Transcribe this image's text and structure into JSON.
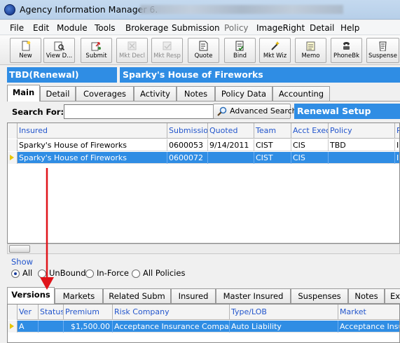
{
  "window": {
    "title": "Agency Information Manager 6."
  },
  "menu": [
    "File",
    "Edit",
    "Module",
    "Tools",
    "Brokerage",
    "Submission",
    "Policy",
    "ImageRight",
    "Detail",
    "Help"
  ],
  "menu_disabled": [
    "Policy"
  ],
  "toolbar": {
    "buttons": [
      {
        "label": "New",
        "icon": "new-document-icon",
        "enabled": true
      },
      {
        "label": "View D...",
        "icon": "view-document-icon",
        "enabled": true
      },
      {
        "label": "Submit",
        "icon": "submit-icon",
        "enabled": true
      },
      {
        "label": "Mkt Decl",
        "icon": "market-decline-icon",
        "enabled": false
      },
      {
        "label": "Mkt Resp",
        "icon": "market-response-icon",
        "enabled": false
      },
      {
        "label": "Quote",
        "icon": "quote-icon",
        "enabled": true
      },
      {
        "label": "Bind",
        "icon": "bind-icon",
        "enabled": true
      },
      {
        "label": "Mkt Wiz",
        "icon": "market-wizard-icon",
        "enabled": true
      },
      {
        "label": "Memo",
        "icon": "memo-icon",
        "enabled": true
      },
      {
        "label": "PhoneBk",
        "icon": "phonebook-icon",
        "enabled": true
      },
      {
        "label": "Suspense",
        "icon": "suspense-icon",
        "enabled": true
      }
    ]
  },
  "status": {
    "left": "TBD(Renewal)",
    "right": "Sparky's House of Fireworks"
  },
  "main_tabs": [
    {
      "label": "Main",
      "active": true
    },
    {
      "label": "Detail",
      "active": false
    },
    {
      "label": "Coverages",
      "active": false
    },
    {
      "label": "Activity",
      "active": false
    },
    {
      "label": "Notes",
      "active": false
    },
    {
      "label": "Policy Data",
      "active": false
    },
    {
      "label": "Accounting",
      "active": false
    }
  ],
  "search": {
    "label": "Search For:",
    "value": "",
    "advanced_button": "Advanced Search",
    "renewal_setup": "Renewal Setup"
  },
  "submissions_grid": {
    "columns": [
      "Insured",
      "Submission",
      "Quoted",
      "Team",
      "Acct Exec",
      "Policy",
      "R"
    ],
    "rows": [
      {
        "cells": [
          "Sparky's House of Fireworks",
          "0600053",
          "9/14/2011",
          "CIST",
          "CIS",
          "TBD",
          "I"
        ],
        "selected": false
      },
      {
        "cells": [
          "Sparky's House of Fireworks",
          "0600072",
          "",
          "CIST",
          "CIS",
          "",
          "I"
        ],
        "selected": true
      }
    ]
  },
  "show": {
    "label": "Show",
    "options": [
      {
        "label": "All",
        "checked": true
      },
      {
        "label": "UnBound",
        "checked": false
      },
      {
        "label": "In-Force",
        "checked": false
      },
      {
        "label": "All Policies",
        "checked": false
      }
    ]
  },
  "bottom_tabs": [
    {
      "label": "Versions",
      "active": true
    },
    {
      "label": "Markets",
      "active": false
    },
    {
      "label": "Related Subm",
      "active": false
    },
    {
      "label": "Insured",
      "active": false
    },
    {
      "label": "Master Insured",
      "active": false
    },
    {
      "label": "Suspenses",
      "active": false
    },
    {
      "label": "Notes",
      "active": false
    },
    {
      "label": "Ex",
      "active": false
    }
  ],
  "versions_grid": {
    "columns": [
      "Ver",
      "Status",
      "Premium",
      "Risk Company",
      "Type/LOB",
      "Market"
    ],
    "rows": [
      {
        "cells": [
          "A",
          "",
          "$1,500.00",
          "Acceptance Insurance Company",
          "Auto Liability",
          "Acceptance Insura"
        ],
        "selected": true
      }
    ]
  },
  "colors": {
    "accent_blue": "#2f8de4",
    "header_text": "#2255cc",
    "annotation_arrow": "#e0141a"
  }
}
